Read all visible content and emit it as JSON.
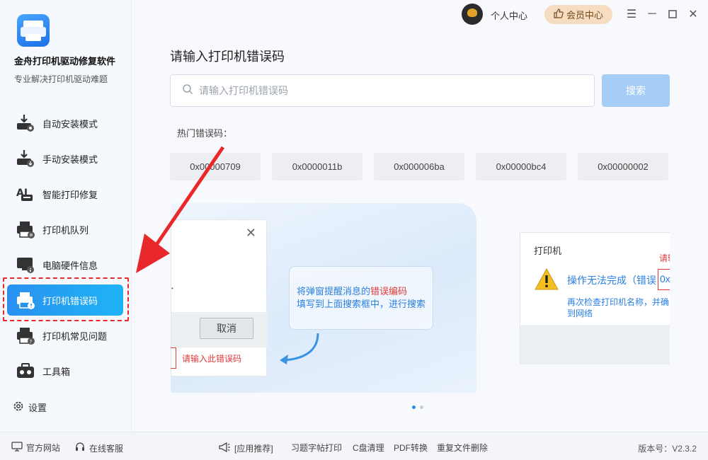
{
  "app": {
    "title": "金舟打印机驱动修复软件",
    "subtitle": "专业解决打印机驱动难题"
  },
  "sidebar": {
    "items": [
      {
        "label": "自动安装模式",
        "icon": "install-download-icon"
      },
      {
        "label": "手动安装模式",
        "icon": "manual-install-icon"
      },
      {
        "label": "智能打印修复",
        "icon": "ai-repair-icon"
      },
      {
        "label": "打印机队列",
        "icon": "printer-queue-icon"
      },
      {
        "label": "电脑硬件信息",
        "icon": "computer-info-icon"
      },
      {
        "label": "打印机错误码",
        "icon": "printer-error-icon",
        "active": true
      },
      {
        "label": "打印机常见问题",
        "icon": "printer-faq-icon"
      },
      {
        "label": "工具箱",
        "icon": "toolbox-icon"
      }
    ],
    "settings_label": "设置"
  },
  "titlebar": {
    "user_label": "个人中心",
    "vip_label": "会员中心"
  },
  "main": {
    "title": "请输入打印机错误码",
    "search_placeholder": "请输入打印机错误码",
    "search_button": "搜索",
    "hot_label": "热门错误码：",
    "hot_codes": [
      "0x00000709",
      "0x0000011b",
      "0x000006ba",
      "0x00000bc4",
      "0x00000002"
    ]
  },
  "banner": {
    "left_cancel": "取消",
    "left_hint": "请输入此错误码",
    "tip_line1_prefix": "将弹窗提醒消息的",
    "tip_line1_highlight": "错误编码",
    "tip_line2": "填写到上面搜索框中，进行搜索",
    "right_title": "打印机",
    "right_partial_red": "请输",
    "right_message": "操作无法完成（错误",
    "right_code_partial": "0x",
    "right_sub1": "再次检查打印机名称，并确",
    "right_sub2": "到网络"
  },
  "footer": {
    "website": "官方网站",
    "service": "在线客服",
    "recommend": "[应用推荐]",
    "links": [
      "习题字帖打印",
      "C盘清理",
      "PDF转换",
      "重复文件删除"
    ],
    "version": "版本号：V2.3.2"
  },
  "colors": {
    "accent": "#2a90f0",
    "highlight_red": "#e8282b",
    "vip_bg": "#f6dcc0"
  }
}
